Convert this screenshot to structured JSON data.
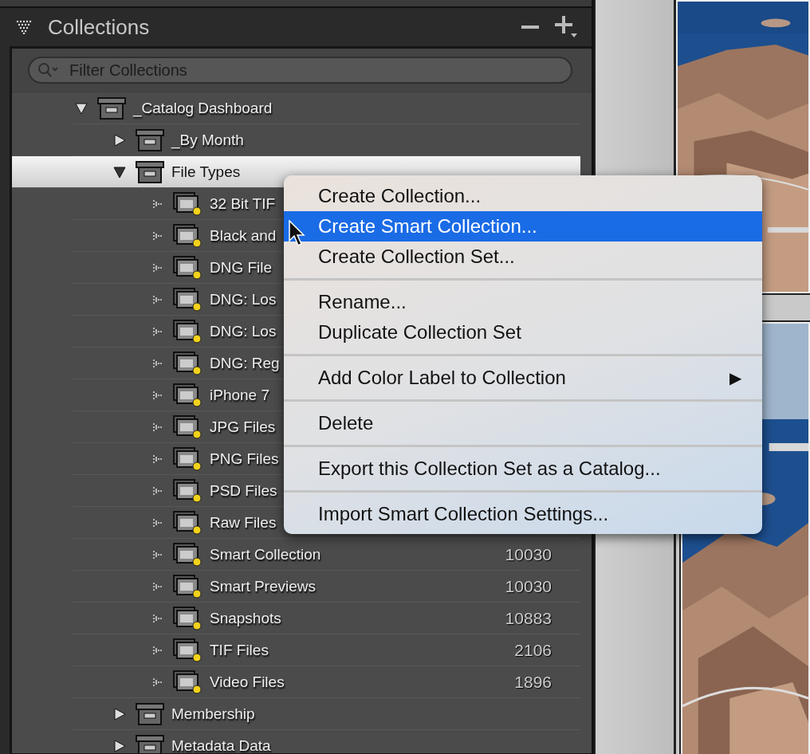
{
  "panel": {
    "title": "Collections",
    "filter": {
      "placeholder": "Filter Collections"
    }
  },
  "tree": [
    {
      "label": "_Catalog Dashboard",
      "kind": "set",
      "expanded": true,
      "selected": false,
      "children": [
        {
          "label": "_By Month",
          "kind": "set",
          "expanded": false,
          "selected": false
        },
        {
          "label": "File Types",
          "kind": "set",
          "expanded": true,
          "selected": true,
          "children": [
            {
              "label": "32 Bit TIF",
              "kind": "smart",
              "selected": false
            },
            {
              "label": "Black and",
              "kind": "smart",
              "selected": false
            },
            {
              "label": "DNG File",
              "kind": "smart",
              "selected": false
            },
            {
              "label": "DNG: Los",
              "kind": "smart",
              "selected": false
            },
            {
              "label": "DNG: Los",
              "kind": "smart",
              "selected": false
            },
            {
              "label": "DNG: Reg",
              "kind": "smart",
              "selected": false
            },
            {
              "label": "iPhone 7",
              "kind": "smart",
              "selected": false
            },
            {
              "label": "JPG Files",
              "kind": "smart",
              "selected": false
            },
            {
              "label": "PNG Files",
              "kind": "smart",
              "selected": false
            },
            {
              "label": "PSD Files",
              "kind": "smart",
              "selected": false
            },
            {
              "label": "Raw Files",
              "kind": "smart",
              "selected": false
            },
            {
              "label": "Smart Collection",
              "kind": "smart",
              "selected": false,
              "count": "10030"
            },
            {
              "label": "Smart Previews",
              "kind": "smart",
              "selected": false,
              "count": "10030"
            },
            {
              "label": "Snapshots",
              "kind": "smart",
              "selected": false,
              "count": "10883"
            },
            {
              "label": "TIF Files",
              "kind": "smart",
              "selected": false,
              "count": "2106"
            },
            {
              "label": "Video Files",
              "kind": "smart",
              "selected": false,
              "count": "1896"
            }
          ]
        },
        {
          "label": "Membership",
          "kind": "set",
          "expanded": false,
          "selected": false
        },
        {
          "label": "Metadata Data",
          "kind": "set",
          "expanded": false,
          "selected": false
        }
      ]
    }
  ],
  "menu": {
    "groups": [
      {
        "items": [
          {
            "label": "Create Collection...",
            "selected": false
          },
          {
            "label": "Create Smart Collection...",
            "selected": true
          },
          {
            "label": "Create Collection Set...",
            "selected": false
          }
        ]
      },
      {
        "items": [
          {
            "label": "Rename...",
            "selected": false
          },
          {
            "label": "Duplicate Collection Set",
            "selected": false
          }
        ]
      },
      {
        "items": [
          {
            "label": "Add Color Label to Collection",
            "selected": false,
            "submenu": "▶"
          }
        ]
      },
      {
        "items": [
          {
            "label": "Delete",
            "selected": false
          }
        ]
      },
      {
        "items": [
          {
            "label": "Export this Collection Set as a Catalog...",
            "selected": false
          }
        ]
      },
      {
        "items": [
          {
            "label": "Import Smart Collection Settings...",
            "selected": false
          }
        ]
      }
    ]
  }
}
